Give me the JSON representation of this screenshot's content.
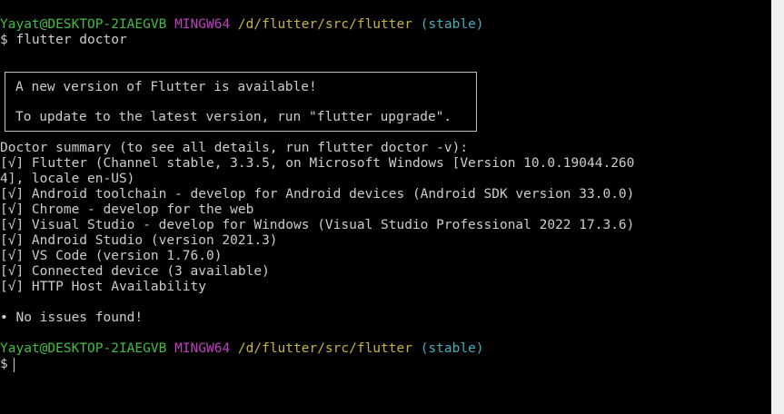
{
  "prompt1": {
    "user": "Yayat@DESKTOP-2IAEGVB",
    "system": "MINGW64",
    "path": "/d/flutter/src/flutter",
    "branch": "(stable)"
  },
  "command_line": "$ flutter doctor",
  "banner": {
    "line1": "A new version of Flutter is available!",
    "line2": "To update to the latest version, run \"flutter upgrade\"."
  },
  "summary_header": "Doctor summary (to see all details, run flutter doctor -v):",
  "checks": [
    "[√] Flutter (Channel stable, 3.3.5, on Microsoft Windows [Version 10.0.19044.260",
    "4], locale en-US)",
    "[√] Android toolchain - develop for Android devices (Android SDK version 33.0.0)",
    "[√] Chrome - develop for the web",
    "[√] Visual Studio - develop for Windows (Visual Studio Professional 2022 17.3.6)",
    "[√] Android Studio (version 2021.3)",
    "[√] VS Code (version 1.76.0)",
    "[√] Connected device (3 available)",
    "[√] HTTP Host Availability"
  ],
  "result": "• No issues found!",
  "prompt2": {
    "user": "Yayat@DESKTOP-2IAEGVB",
    "system": "MINGW64",
    "path": "/d/flutter/src/flutter",
    "branch": "(stable)"
  },
  "input_prompt": "$ "
}
